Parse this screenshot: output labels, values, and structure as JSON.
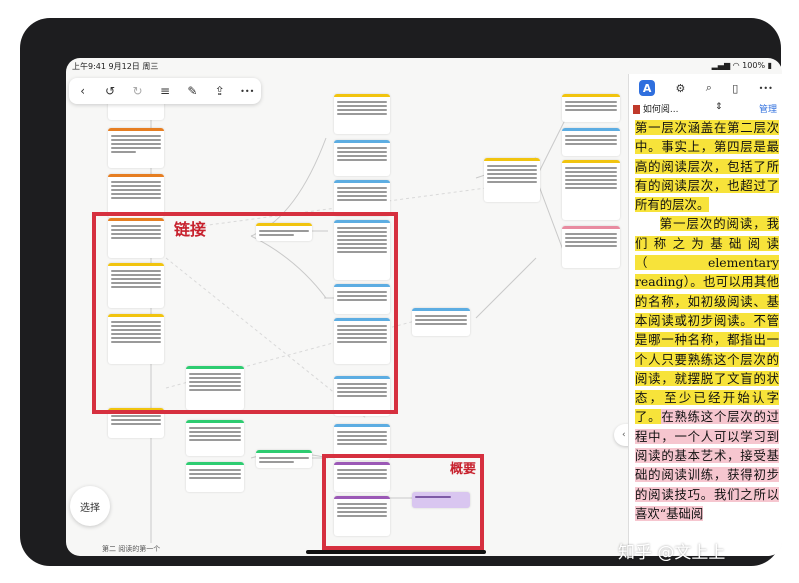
{
  "status": {
    "time": "上午9:41",
    "date": "9月12日 周三",
    "battery": "100%"
  },
  "toolbar": {
    "back": "‹",
    "undo": "↺",
    "redo": "↻",
    "list": "≡",
    "edit": "✎",
    "share": "⇪",
    "more": "•••"
  },
  "canvas": {
    "annotation_link": "链接",
    "annotation_summary": "概要",
    "select_label": "选择",
    "footer_tab": "第二 阅读的第一个"
  },
  "panel": {
    "doc_title": "如何阅...",
    "manage_label": "管理",
    "paragraph1": "第一层次涵盖在第二层次中。事实上，第四层是最高的阅读层次，包括了所有的阅读层次，也超过了所有的层次。",
    "paragraph2_start": "第一层次的阅读，我们称之为基础阅读（elementary reading）。也可以用其他的名称，如初级阅读、基本阅读或初步阅读。不管是哪一种名称，都指出一个人只要熟练这个层次的阅读，就摆脱了文盲的状态，至少已经开始认字了。",
    "paragraph2_end": "在熟练这个层次的过程中，一个人可以学习到阅读的基本艺术，接受基础的阅读训练，获得初步的阅读技巧。我们之所以喜欢“基础阅"
  },
  "pager": {
    "label": "‹ ›"
  },
  "watermark": {
    "text": "知乎 @文上上"
  },
  "colors": {
    "highlight_red": "#d6303f",
    "marker_yellow": "#f7e33a",
    "marker_blue": "#c8d8f3",
    "marker_pink": "#f6c6cf",
    "accent": "#2f6fde"
  }
}
